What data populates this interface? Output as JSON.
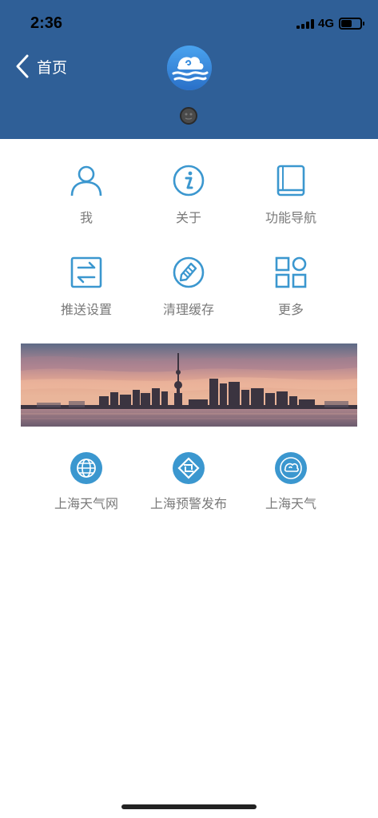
{
  "status_bar": {
    "time": "2:36",
    "network": "4G",
    "battery_level": 0.55
  },
  "header": {
    "back_label": "首页",
    "background_color": "#2f5f97"
  },
  "menu": {
    "items": [
      {
        "label": "我",
        "icon": "person-icon"
      },
      {
        "label": "关于",
        "icon": "info-icon"
      },
      {
        "label": "功能导航",
        "icon": "book-icon"
      },
      {
        "label": "推送设置",
        "icon": "push-settings-icon"
      },
      {
        "label": "清理缓存",
        "icon": "broom-icon"
      },
      {
        "label": "更多",
        "icon": "grid-more-icon"
      }
    ]
  },
  "links": {
    "items": [
      {
        "label": "上海天气网",
        "icon": "globe-icon"
      },
      {
        "label": "上海预警发布",
        "icon": "warning-logo-icon"
      },
      {
        "label": "上海天气",
        "icon": "weather-logo-icon"
      }
    ]
  },
  "colors": {
    "accent": "#3b97cf",
    "label": "#7a7a7a"
  }
}
